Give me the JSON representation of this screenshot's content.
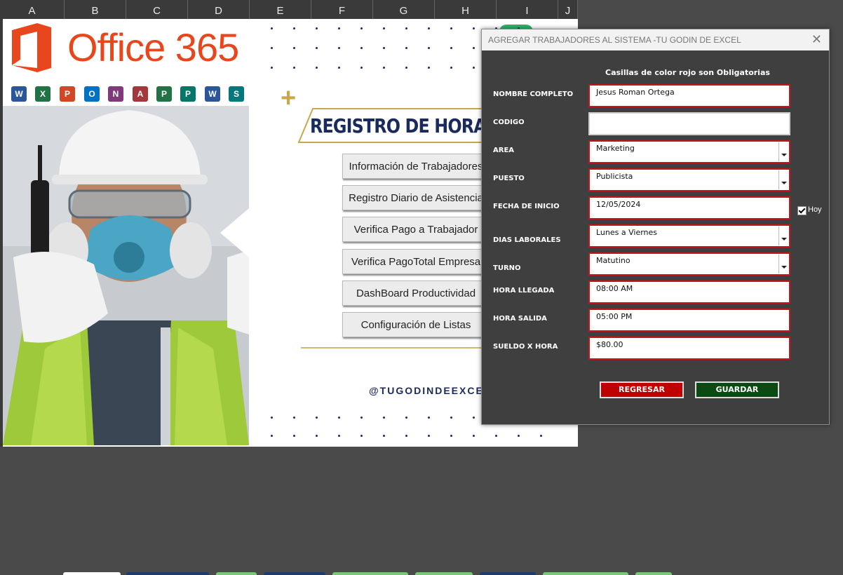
{
  "columns": [
    "A",
    "B",
    "C",
    "D",
    "E",
    "F",
    "G",
    "H",
    "I",
    "J"
  ],
  "logo": {
    "text": "Office 365"
  },
  "app_icons": [
    {
      "letter": "W",
      "color": "#2b579a"
    },
    {
      "letter": "X",
      "color": "#217346"
    },
    {
      "letter": "P",
      "color": "#d24726"
    },
    {
      "letter": "O",
      "color": "#0072c6"
    },
    {
      "letter": "N",
      "color": "#80397b"
    },
    {
      "letter": "A",
      "color": "#a4373a"
    },
    {
      "letter": "P",
      "color": "#217346"
    },
    {
      "letter": "P",
      "color": "#077568"
    },
    {
      "letter": "W",
      "color": "#2b579a"
    },
    {
      "letter": "S",
      "color": "#03787c"
    }
  ],
  "banner": {
    "title": "REGISTRO DE HORAS DE T"
  },
  "menu": [
    "Información de Trabajadores",
    "Registro Diario de Asistencia",
    "Verifica Pago a Trabajador",
    "Verifica PagoTotal Empresa",
    "DashBoard Productividad",
    "Configuración de Listas"
  ],
  "handle": "@TUGODINDEEXCEL",
  "dialog": {
    "title": "AGREGAR TRABAJADORES AL SISTEMA -TU GODIN DE EXCEL",
    "close": "✕",
    "note": "Casillas de color rojo son Obligatorias",
    "fields": {
      "nombre": {
        "label": "NOMBRE COMPLETO",
        "value": "Jesus Roman Ortega"
      },
      "codigo": {
        "label": "CODIGO",
        "value": ""
      },
      "area": {
        "label": "AREA",
        "value": "Marketing"
      },
      "puesto": {
        "label": "PUESTO",
        "value": "Publicista"
      },
      "fecha": {
        "label": "FECHA DE INICIO",
        "value": "12/05/2024"
      },
      "dias": {
        "label": "DIAS LABORALES",
        "value": "Lunes a Viernes"
      },
      "turno": {
        "label": "TURNO",
        "value": "Matutino"
      },
      "llegada": {
        "label": "HORA LLEGADA",
        "value": "08:00 AM"
      },
      "salida": {
        "label": "HORA SALIDA",
        "value": "05:00 PM"
      },
      "sueldo": {
        "label": "SUELDO X HORA",
        "value": "$80.00"
      }
    },
    "hoy": {
      "label": "Hoy",
      "checked": true
    },
    "buttons": {
      "regresar": "REGRESAR",
      "guardar": "GUARDAR"
    }
  },
  "colors": {
    "required_border": "#c1171c",
    "regresar": "#c00000",
    "guardar": "#0b4a12",
    "accent_gold": "#c9a84c",
    "navy": "#1b2a5c"
  }
}
